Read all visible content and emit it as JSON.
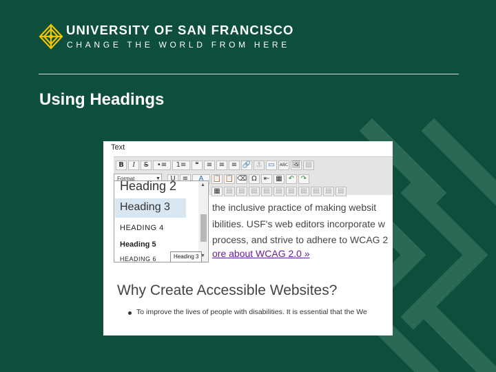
{
  "brand": {
    "name": "UNIVERSITY OF SAN FRANCISCO",
    "tagline": "CHANGE THE WORLD FROM HERE",
    "accent_color": "#0d4f3c",
    "logo_color": "#f2c500"
  },
  "slide": {
    "title": "Using Headings"
  },
  "screenshot": {
    "panel_label": "Text",
    "toolbar": {
      "row1": [
        "B",
        "I",
        "S",
        "•≡",
        "1≡",
        "❝",
        "≡",
        "≡",
        "≡",
        "🔗",
        "⚓",
        "▭",
        "ABC",
        "🖼",
        "▤"
      ],
      "row2": [
        "U",
        "≡",
        "A",
        "📋",
        "📋",
        "⌫",
        "Ω",
        "⇤",
        "▦",
        "↶",
        "↷"
      ],
      "row3": [
        "▦",
        "▤",
        "▤",
        "▤",
        "▤",
        "▤",
        "▤",
        "▤",
        "▤",
        "▤",
        "▤"
      ],
      "format_label": "Format"
    },
    "format_dropdown": {
      "items": [
        "Heading 2",
        "Heading 3",
        "HEADING 4",
        "Heading 5",
        "HEADING 6"
      ],
      "highlighted": "Heading 3",
      "tooltip": "Heading 3"
    },
    "content": {
      "line1": "the inclusive practice of making websit",
      "line2": "ibilities. USF's web editors incorporate w",
      "line3": "process, and strive to adhere to WCAG 2",
      "link": "ore about WCAG 2.0 »",
      "heading": "Why Create Accessible Websites?",
      "bullet": "To improve the lives of people with disabilities. It is essential that the We"
    }
  }
}
